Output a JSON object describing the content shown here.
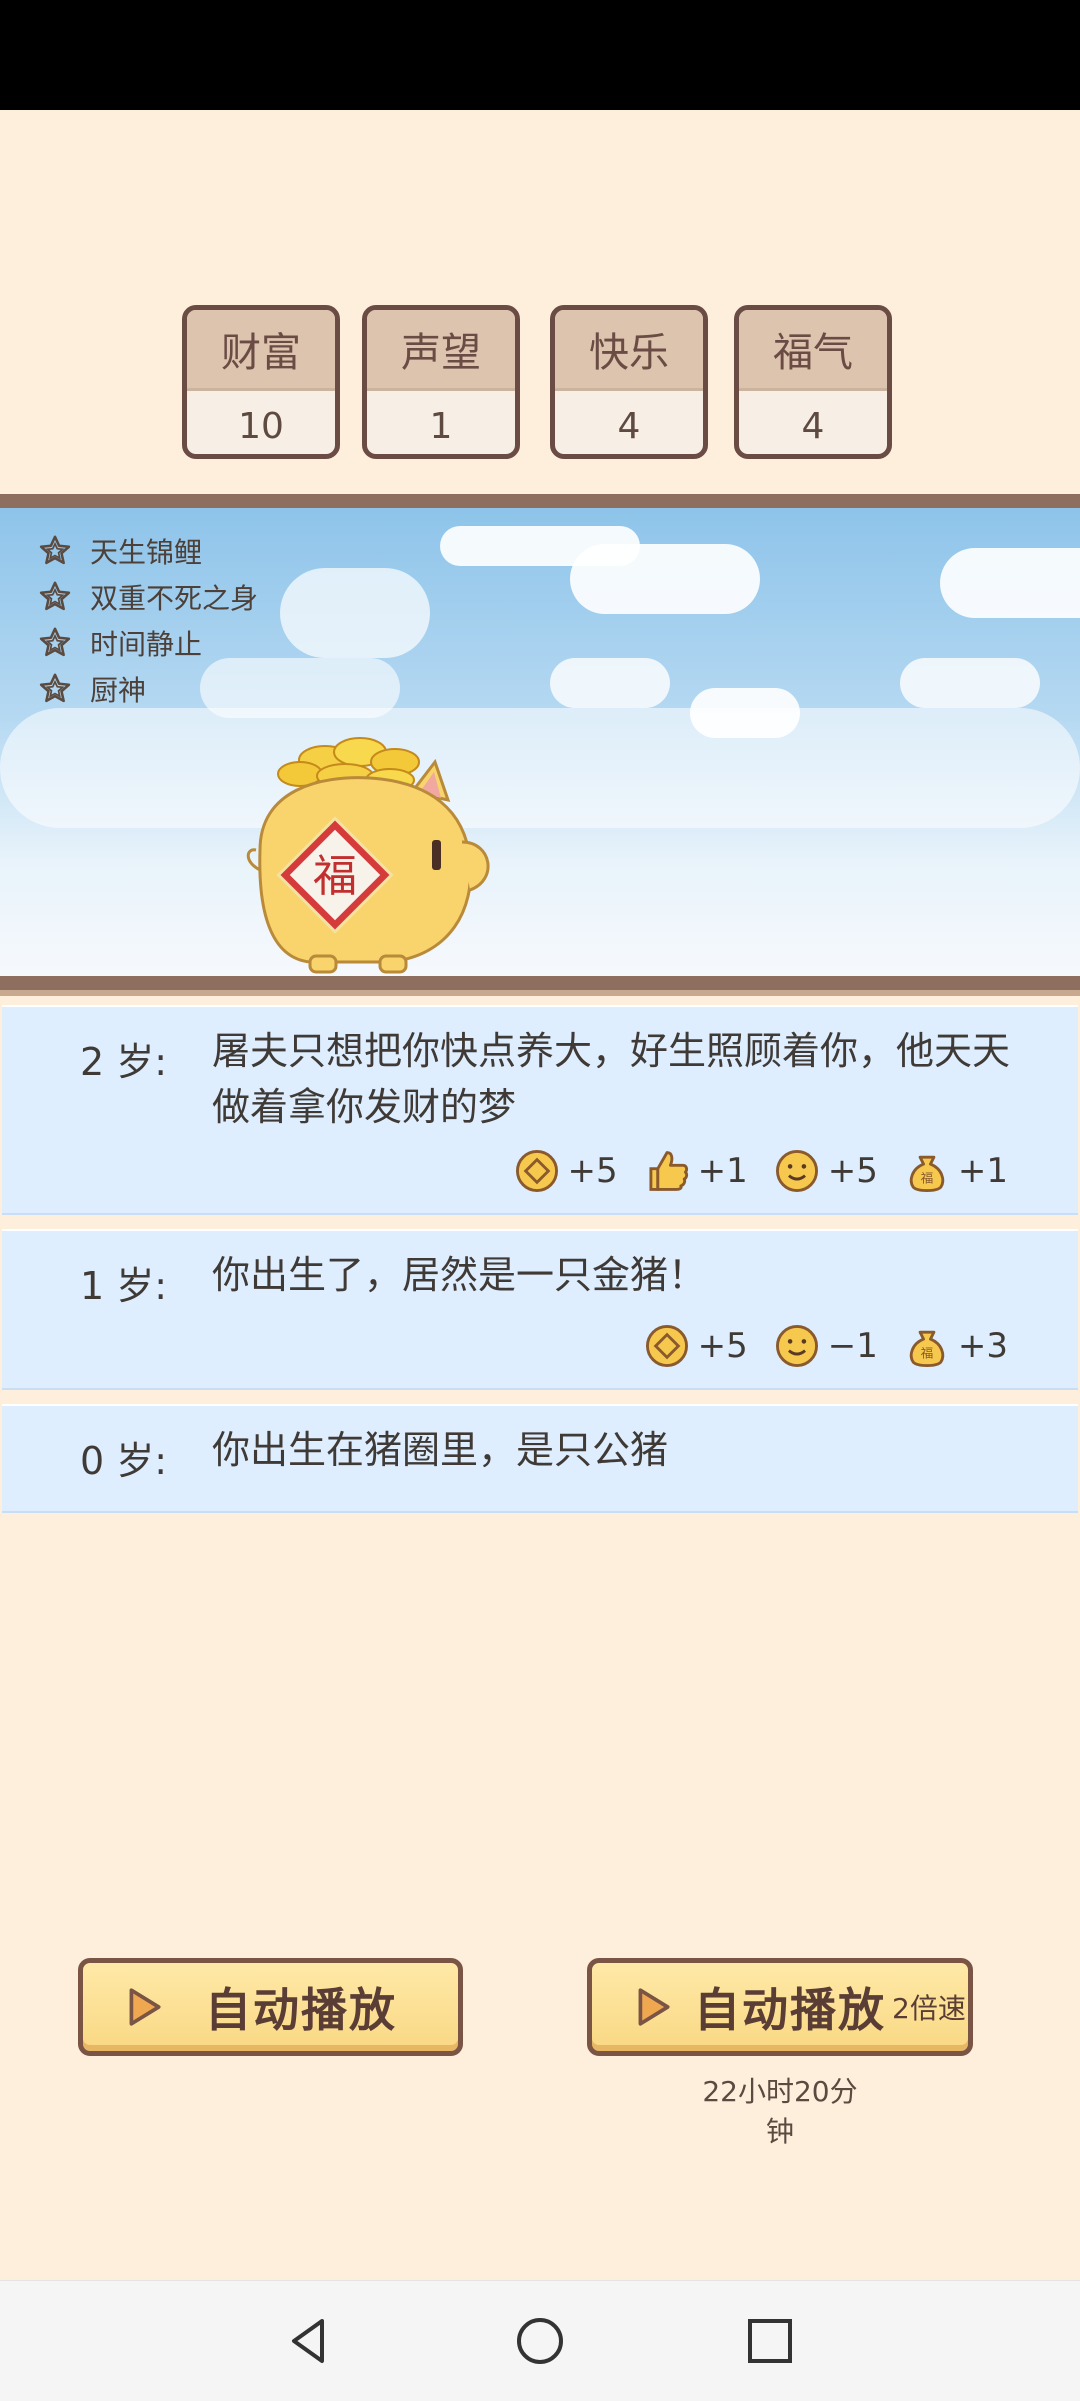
{
  "stats": [
    {
      "label": "财富",
      "value": "10"
    },
    {
      "label": "声望",
      "value": "1"
    },
    {
      "label": "快乐",
      "value": "4"
    },
    {
      "label": "福气",
      "value": "4"
    }
  ],
  "talents": [
    "天生锦鲤",
    "双重不死之身",
    "时间静止",
    "厨神"
  ],
  "pig_badge": "福",
  "events": [
    {
      "age": "2 岁:",
      "text": "屠夫只想把你快点养大，好生照顾着你，他天天做着拿你发财的梦",
      "effects": [
        {
          "icon": "coin-icon",
          "value": "+5"
        },
        {
          "icon": "thumbs-up-icon",
          "value": "+1"
        },
        {
          "icon": "smiley-icon",
          "value": "+5"
        },
        {
          "icon": "lucky-bag-icon",
          "value": "+1"
        }
      ]
    },
    {
      "age": "1 岁:",
      "text": "你出生了，居然是一只金猪！",
      "effects": [
        {
          "icon": "coin-icon",
          "value": "+5"
        },
        {
          "icon": "smiley-icon",
          "value": "−1"
        },
        {
          "icon": "lucky-bag-icon",
          "value": "+3"
        }
      ]
    },
    {
      "age": "0 岁:",
      "text": "你出生在猪圈里，是只公猪",
      "effects": []
    }
  ],
  "buttons": {
    "auto_play": "自动播放",
    "auto_play_fast": "自动播放",
    "speed_label": "2倍速",
    "timer": "22小时20分钟"
  },
  "colors": {
    "background": "#fdefdc",
    "card_border": "#6b4c45",
    "event_bg": "#deeefe",
    "button_fill": "#f9d884"
  }
}
